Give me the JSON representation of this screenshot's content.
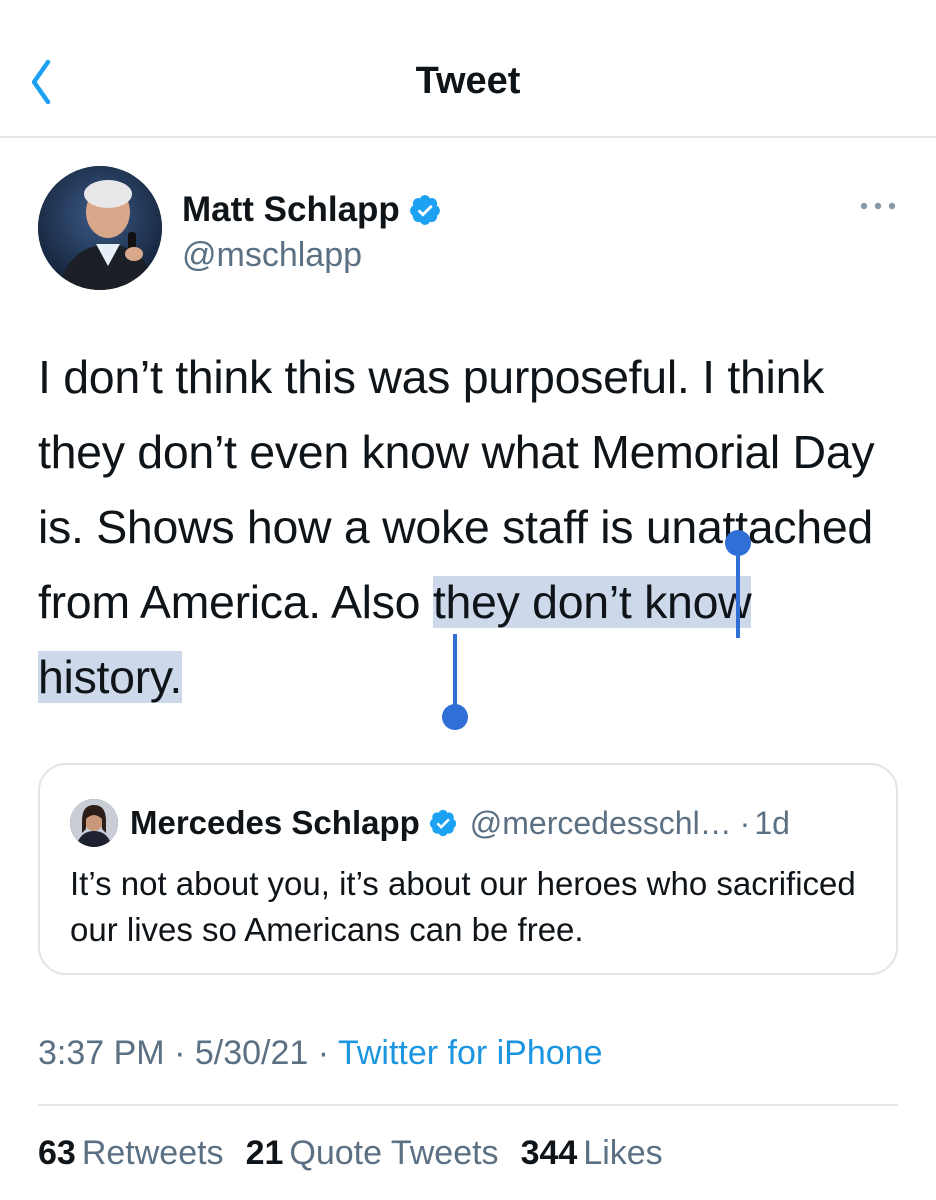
{
  "nav": {
    "title": "Tweet",
    "back_icon": "chevron-left-icon",
    "accent": "#1da1f2"
  },
  "author": {
    "name": "Matt Schlapp",
    "handle": "@mschlapp",
    "verified": true
  },
  "tweet": {
    "text_before": "I don’t think this was purposeful. I think they don’t even know what Memorial Day is.  Shows how a woke staff is unattached from America. Also ",
    "text_selected": "they don’t know history.",
    "selection_color": "#cdd9ea"
  },
  "quote": {
    "name": "Mercedes Schlapp",
    "handle": "@mercedesschl…",
    "separator": "·",
    "time": "1d",
    "verified": true,
    "text": "It’s not about you, it’s about our heroes who sacrificed our lives so Americans can be free."
  },
  "meta": {
    "time": "3:37 PM",
    "date": "5/30/21",
    "separator": "·",
    "source": "Twitter for iPhone"
  },
  "stats": {
    "retweets_count": "63",
    "retweets_label": "Retweets",
    "quotes_count": "21",
    "quotes_label": "Quote Tweets",
    "likes_count": "344",
    "likes_label": "Likes"
  }
}
